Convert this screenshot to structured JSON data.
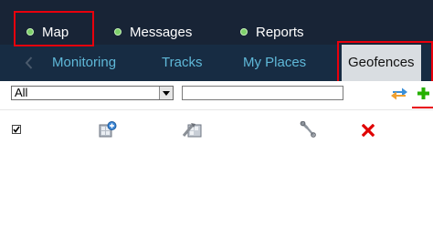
{
  "top_nav": {
    "items": [
      {
        "label": "Map"
      },
      {
        "label": "Messages"
      },
      {
        "label": "Reports"
      }
    ]
  },
  "sub_nav": {
    "items": [
      {
        "label": "Monitoring"
      },
      {
        "label": "Tracks"
      },
      {
        "label": "My Places"
      },
      {
        "label": "Geofences"
      }
    ]
  },
  "toolbar": {
    "filter_value": "All",
    "search_value": ""
  },
  "colors": {
    "top_bar": "#182436",
    "sub_bar": "#172c43",
    "tab_link": "#5fb8d8",
    "highlight": "#e8000c",
    "add": "#25b000",
    "delete": "#e00000"
  },
  "icons": [
    "back-chevron-icon",
    "sync-icon",
    "add-icon",
    "select-all-checkbox",
    "geofence-group-icon",
    "edit-geofence-icon",
    "settings-wrench-icon",
    "delete-icon"
  ]
}
